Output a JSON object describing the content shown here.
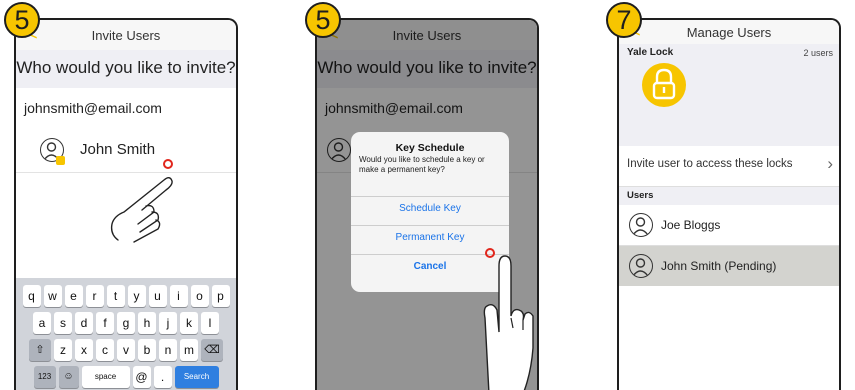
{
  "panels": [
    {
      "step": "5",
      "nav_back": "<",
      "nav_title": "Invite Users",
      "question": "Who would you like to invite?",
      "email": "johnsmith@email.com",
      "contact_name": "John Smith",
      "keyboard": {
        "row1": [
          "q",
          "w",
          "e",
          "r",
          "t",
          "y",
          "u",
          "i",
          "o",
          "p"
        ],
        "row2": [
          "a",
          "s",
          "d",
          "f",
          "g",
          "h",
          "j",
          "k",
          "l"
        ],
        "row3": [
          "z",
          "x",
          "c",
          "v",
          "b",
          "n",
          "m"
        ],
        "num_key": "123",
        "space_key": "space",
        "at_key": "@",
        "dot_key": ".",
        "search_key": "Search"
      }
    },
    {
      "step": "5",
      "nav_back": "<",
      "nav_title": "Invite Users",
      "question": "Who would you like to invite?",
      "email": "johnsmith@email.com",
      "dialog": {
        "title": "Key Schedule",
        "message": "Would you like to schedule a key or make a permanent key?",
        "buttons": [
          "Schedule Key",
          "Permanent Key",
          "Cancel"
        ]
      }
    },
    {
      "step": "7",
      "nav_back": "<",
      "nav_title": "Manage Users",
      "lock_name": "Yale Lock",
      "user_count": "2 users",
      "invite_text": "Invite user to access these locks",
      "users_header": "Users",
      "users": [
        "Joe Bloggs",
        "John Smith (Pending)"
      ]
    }
  ],
  "colors": {
    "accent_yellow": "#f7c500",
    "link_blue": "#1a73e8",
    "tap_red": "#e1261c",
    "selected_row": "#d3d3cf"
  }
}
